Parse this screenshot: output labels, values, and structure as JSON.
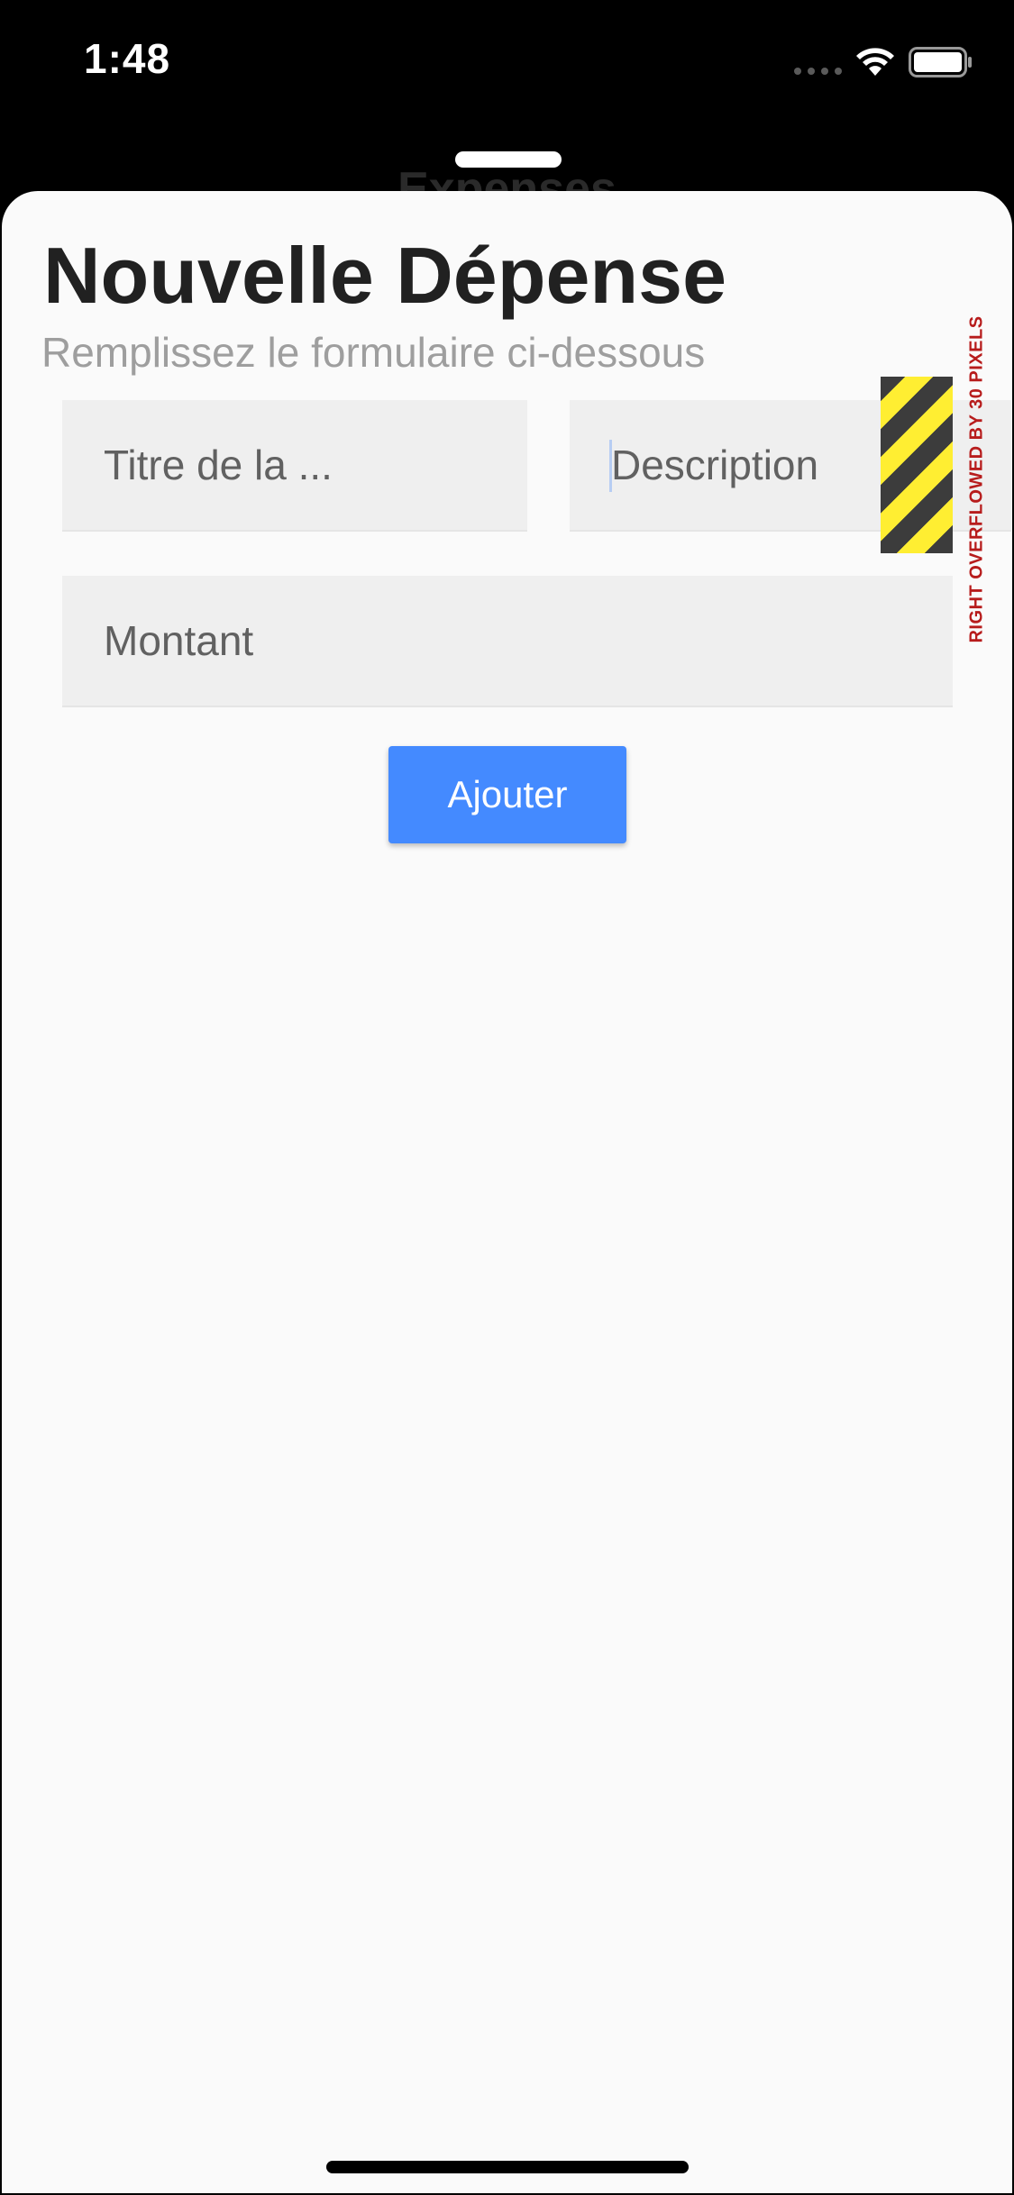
{
  "status_bar": {
    "time": "1:48",
    "signal_icon": "signal-dots-icon",
    "wifi_icon": "wifi-icon",
    "battery_icon": "battery-icon"
  },
  "background_screen": {
    "title": "Expenses"
  },
  "sheet": {
    "title": "Nouvelle Dépense",
    "subtitle": "Remplissez le formulaire ci-dessous",
    "fields": {
      "title_placeholder": "Titre de la ...",
      "description_placeholder": "Description",
      "amount_placeholder": "Montant"
    },
    "submit_label": "Ajouter",
    "overflow_warning": "RIGHT OVERFLOWED BY 30 PIXELS"
  },
  "colors": {
    "accent": "#448aff",
    "sheet_background": "#fafafa",
    "field_background": "#efefef",
    "overflow_text": "#b71c1c",
    "warning_yellow": "#ffee32",
    "warning_dark": "#3c3c3c"
  }
}
